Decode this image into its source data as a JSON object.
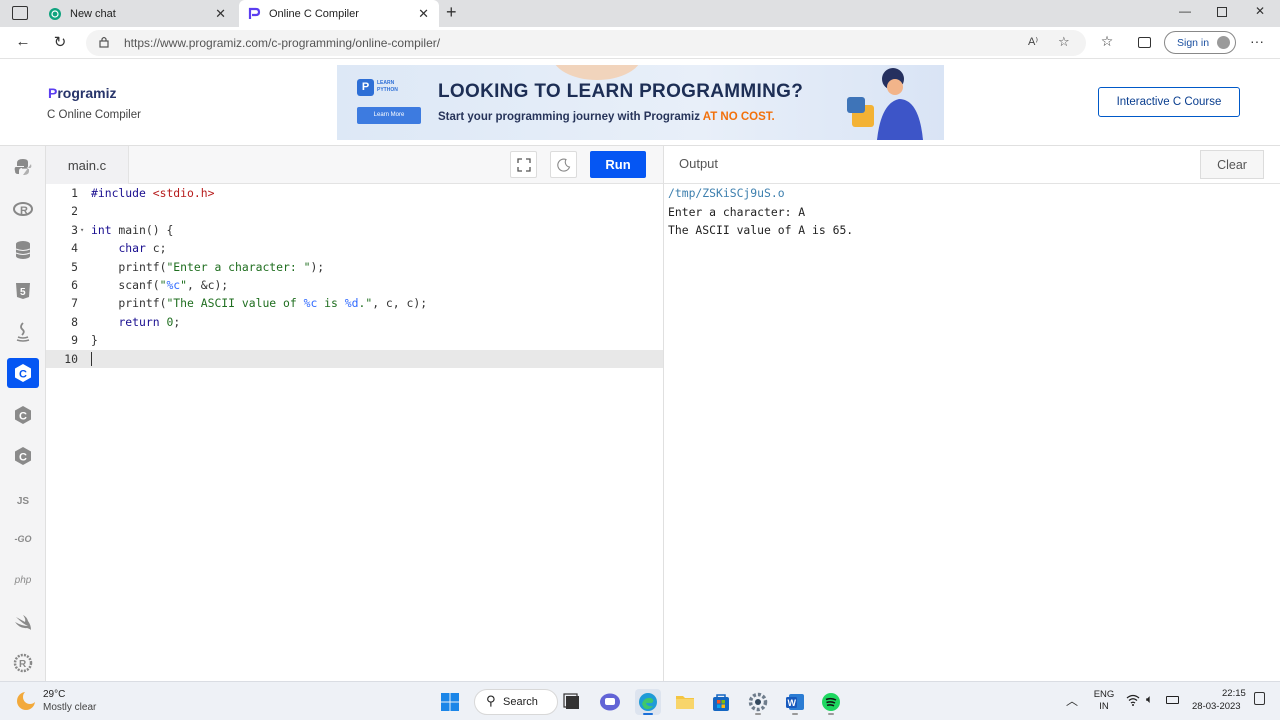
{
  "browser": {
    "tabs": [
      {
        "label": "New chat",
        "icon": "chat-icon"
      },
      {
        "label": "Online C Compiler",
        "icon": "programiz-icon"
      }
    ],
    "url": "https://www.programiz.com/c-programming/online-compiler/",
    "signin_label": "Sign in"
  },
  "header": {
    "logo_text": "rogramiz",
    "logo_p": "P",
    "subtitle": "C Online Compiler",
    "banner": {
      "badge_line1": "LEARN",
      "badge_line2": "PYTHON",
      "badge_button": "Learn More",
      "headline": "LOOKING TO LEARN PROGRAMMING?",
      "subline": "Start your programming journey with Programiz ",
      "subline_highlight": "AT NO COST."
    },
    "course_button": "Interactive C Course"
  },
  "sidebar": {
    "items": [
      {
        "name": "python",
        "label": ""
      },
      {
        "name": "r",
        "label": ""
      },
      {
        "name": "sql",
        "label": ""
      },
      {
        "name": "html5",
        "label": ""
      },
      {
        "name": "java",
        "label": ""
      },
      {
        "name": "c",
        "label": "",
        "active": true
      },
      {
        "name": "cpp",
        "label": ""
      },
      {
        "name": "csharp",
        "label": ""
      },
      {
        "name": "javascript",
        "label": "JS"
      },
      {
        "name": "go",
        "label": "-GO"
      },
      {
        "name": "php",
        "label": "php"
      },
      {
        "name": "swift",
        "label": ""
      },
      {
        "name": "rust",
        "label": ""
      }
    ]
  },
  "editor": {
    "filename": "main.c",
    "run_label": "Run",
    "lines": [
      "1",
      "2",
      "3",
      "4",
      "5",
      "6",
      "7",
      "8",
      "9",
      "10"
    ],
    "code": {
      "l1a": "#include ",
      "l1b": "<stdio.h>",
      "l3a": "int",
      "l3b": " main() {",
      "l4a": "    ",
      "l4b": "char",
      "l4c": " c;",
      "l5a": "    printf(",
      "l5b": "\"Enter a character: \"",
      "l5c": ");",
      "l6a": "    scanf(",
      "l6b": "\"",
      "l6c": "%c",
      "l6d": "\"",
      "l6e": ", &c);",
      "l7a": "    printf(",
      "l7b": "\"The ASCII value of ",
      "l7c": "%c",
      "l7d": " is ",
      "l7e": "%d",
      "l7f": ".\"",
      "l7g": ", c, c);",
      "l8a": "    ",
      "l8b": "return",
      "l8c": " ",
      "l8d": "0",
      "l8e": ";",
      "l9": "}"
    }
  },
  "output": {
    "label": "Output",
    "clear_label": "Clear",
    "lines": [
      "/tmp/ZSKiSCj9uS.o",
      "Enter a character: A",
      "The ASCII value of A is 65."
    ]
  },
  "taskbar": {
    "temperature": "29°C",
    "condition": "Mostly clear",
    "search_label": "Search",
    "lang1": "ENG",
    "lang2": "IN",
    "time": "22:15",
    "date": "28-03-2023"
  },
  "colors": {
    "accent": "#0556f3",
    "brand": "#27346a"
  }
}
